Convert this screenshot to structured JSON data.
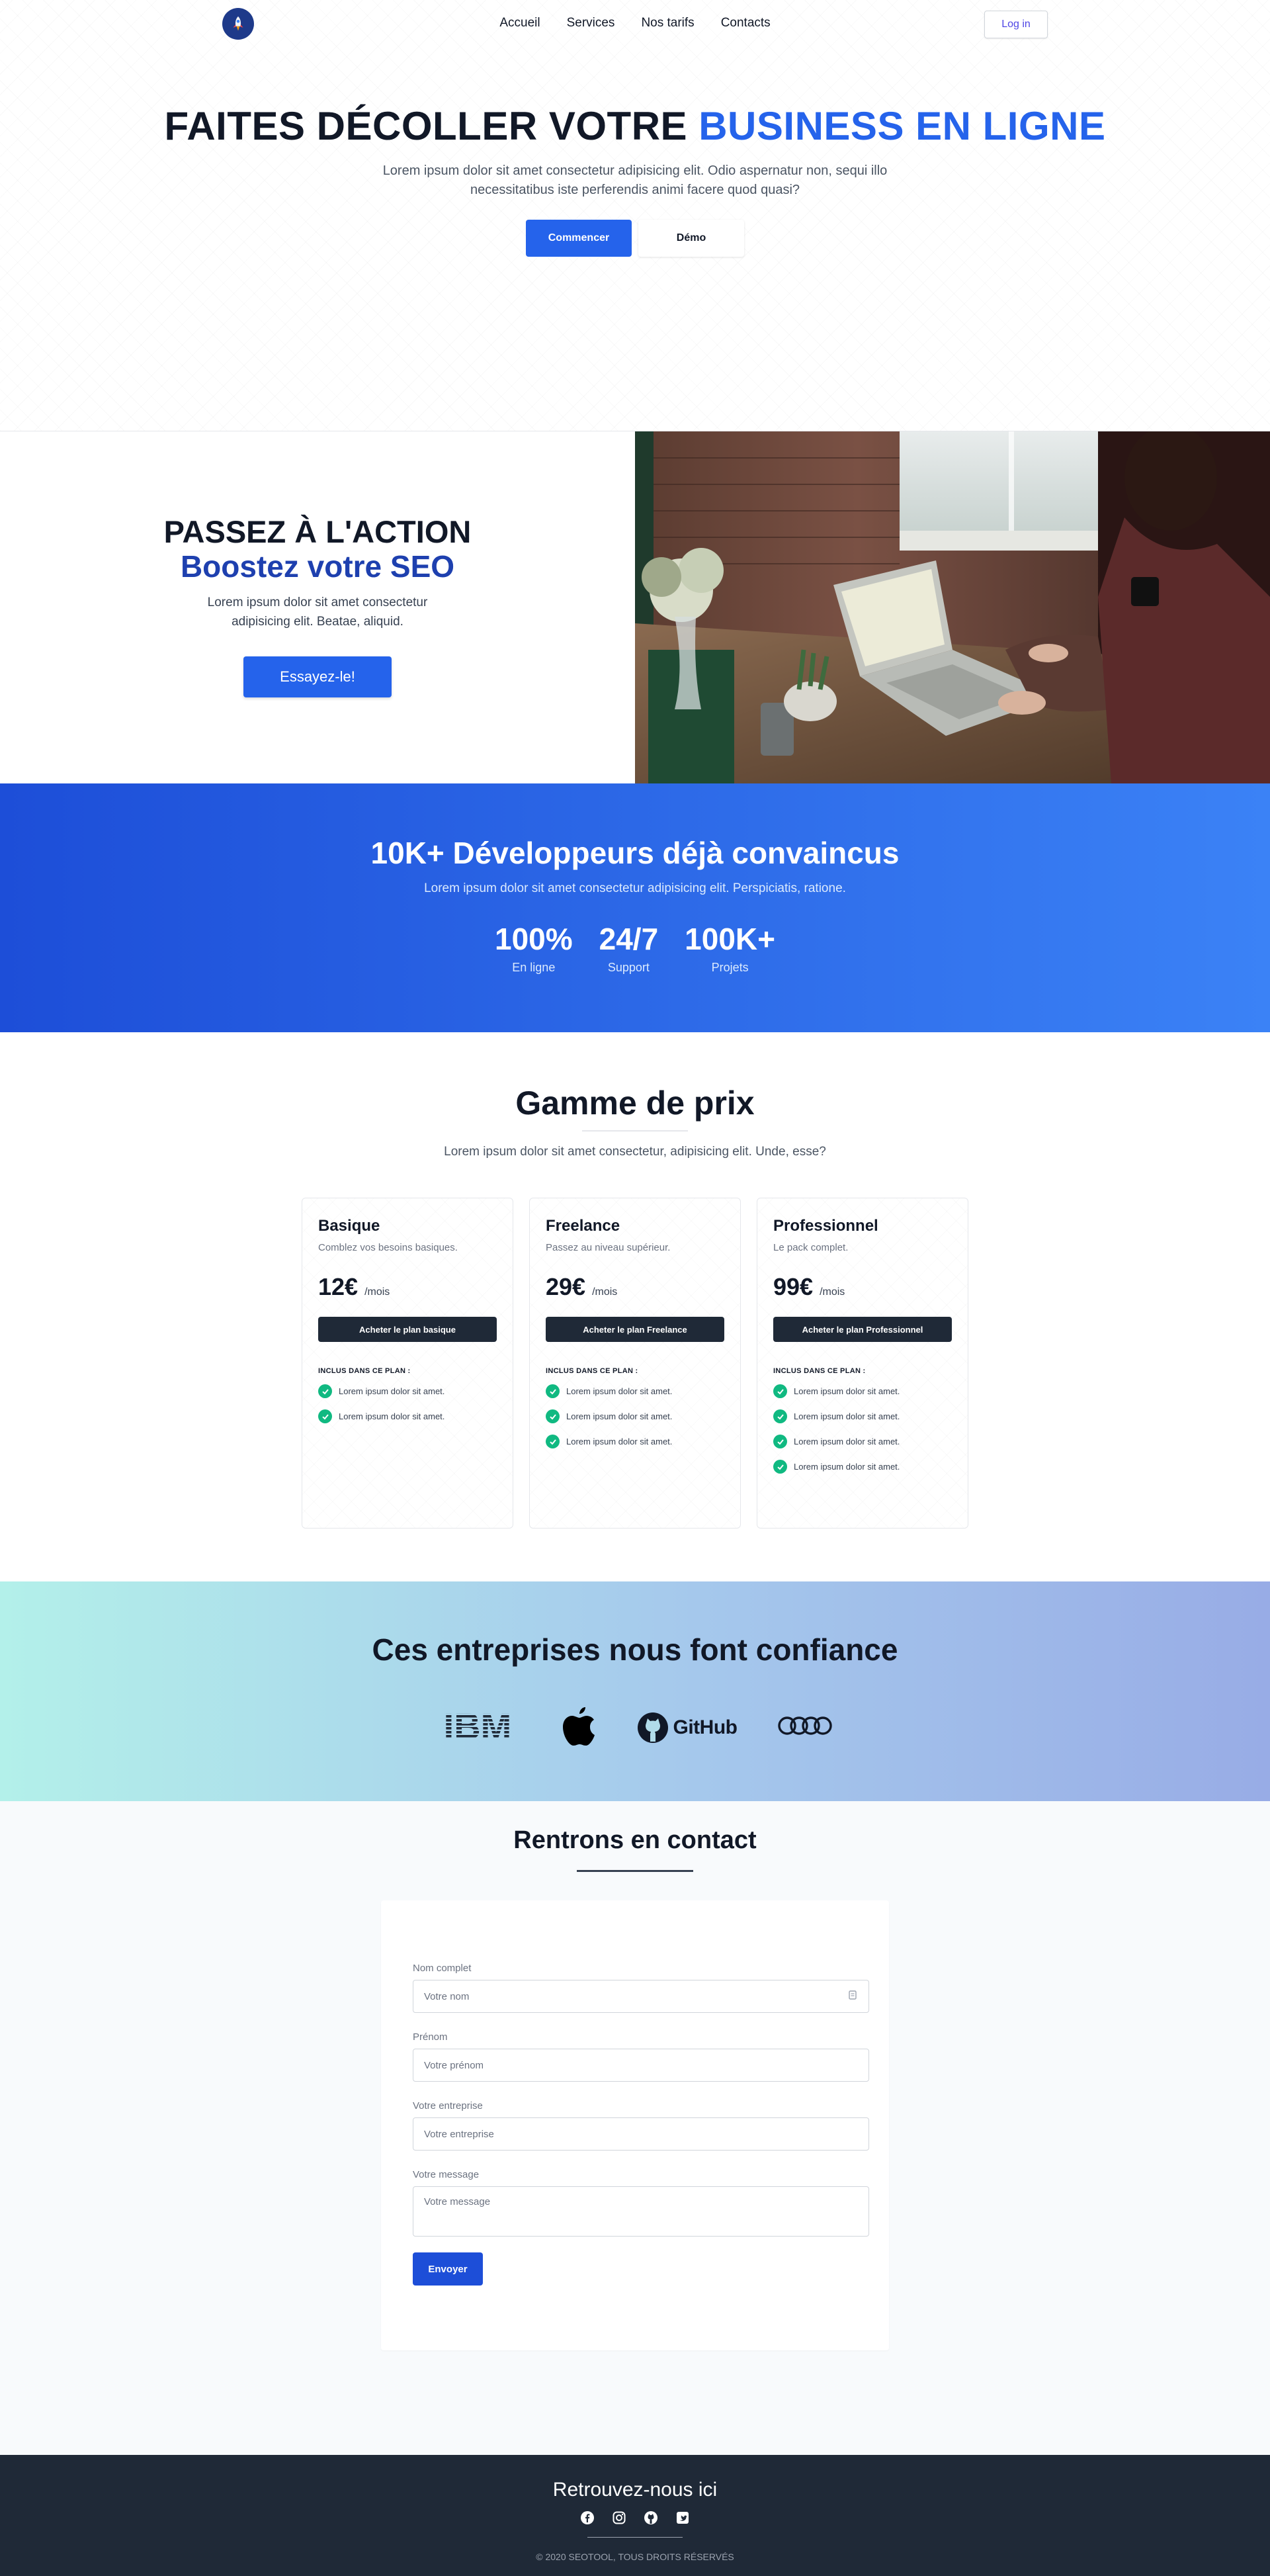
{
  "nav": {
    "logo_icon": "rocket-icon",
    "links": [
      "Accueil",
      "Services",
      "Nos tarifs",
      "Contacts"
    ],
    "login_label": "Log in"
  },
  "hero": {
    "title_part1": "FAITES DÉCOLLER VOTRE",
    "title_part2": "BUSINESS EN LIGNE",
    "text": "Lorem ipsum dolor sit amet consectetur adipisicing elit. Odio aspernatur non, sequi illo necessitatibus iste perferendis animi facere quod quasi?",
    "primary_btn": "Commencer",
    "secondary_btn": "Démo",
    "accent_color": "#2563eb"
  },
  "action": {
    "title": "PASSEZ À L'ACTION",
    "subtitle": "Boostez votre SEO",
    "text": "Lorem ipsum dolor sit amet consectetur adipisicing elit. Beatae, aliquid.",
    "button": "Essayez-le!"
  },
  "stats": {
    "title": "10K+ Développeurs déjà convaincus",
    "text": "Lorem ipsum dolor sit amet consectetur adipisicing elit. Perspiciatis, ratione.",
    "items": [
      {
        "value": "100%",
        "label": "En ligne"
      },
      {
        "value": "24/7",
        "label": "Support"
      },
      {
        "value": "100K+",
        "label": "Projets"
      }
    ]
  },
  "pricing": {
    "title": "Gamme de prix",
    "text": "Lorem ipsum dolor sit amet consectetur, adipisicing elit. Unde, esse?",
    "plans": [
      {
        "name": "Basique",
        "desc": "Comblez vos besoins basiques.",
        "price": "12€",
        "per": "/mois",
        "button": "Acheter le plan basique",
        "included": "INCLUS DANS CE PLAN :",
        "features": [
          "Lorem ipsum dolor sit amet.",
          "Lorem ipsum dolor sit amet."
        ]
      },
      {
        "name": "Freelance",
        "desc": "Passez au niveau supérieur.",
        "price": "29€",
        "per": "/mois",
        "button": "Acheter le plan Freelance",
        "included": "INCLUS DANS CE PLAN :",
        "features": [
          "Lorem ipsum dolor sit amet.",
          "Lorem ipsum dolor sit amet.",
          "Lorem ipsum dolor sit amet."
        ]
      },
      {
        "name": "Professionnel",
        "desc": "Le pack complet.",
        "price": "99€",
        "per": "/mois",
        "button": "Acheter le plan Professionnel",
        "included": "INCLUS DANS CE PLAN :",
        "features": [
          "Lorem ipsum dolor sit amet.",
          "Lorem ipsum dolor sit amet.",
          "Lorem ipsum dolor sit amet.",
          "Lorem ipsum dolor sit amet."
        ]
      }
    ]
  },
  "trust": {
    "title": "Ces entreprises nous font confiance",
    "logos": [
      {
        "icon": "ibm-logo",
        "text": "IBM"
      },
      {
        "icon": "apple-logo"
      },
      {
        "icon": "github-logo",
        "text": "GitHub"
      },
      {
        "icon": "audi-logo"
      }
    ]
  },
  "contact": {
    "title": "Rentrons en contact",
    "fields": [
      {
        "label": "Nom complet",
        "placeholder": "Votre nom"
      },
      {
        "label": "Prénom",
        "placeholder": "Votre prénom"
      },
      {
        "label": "Votre entreprise",
        "placeholder": "Votre entreprise"
      },
      {
        "label": "Votre message",
        "placeholder": "Votre message"
      }
    ],
    "submit": "Envoyer"
  },
  "footer": {
    "title": "Retrouvez-nous ici",
    "social_icons": [
      "facebook-icon",
      "instagram-icon",
      "github-icon",
      "twitter-icon"
    ],
    "copyright": "© 2020 SEOTOOL, TOUS DROITS RÉSERVÉS"
  }
}
